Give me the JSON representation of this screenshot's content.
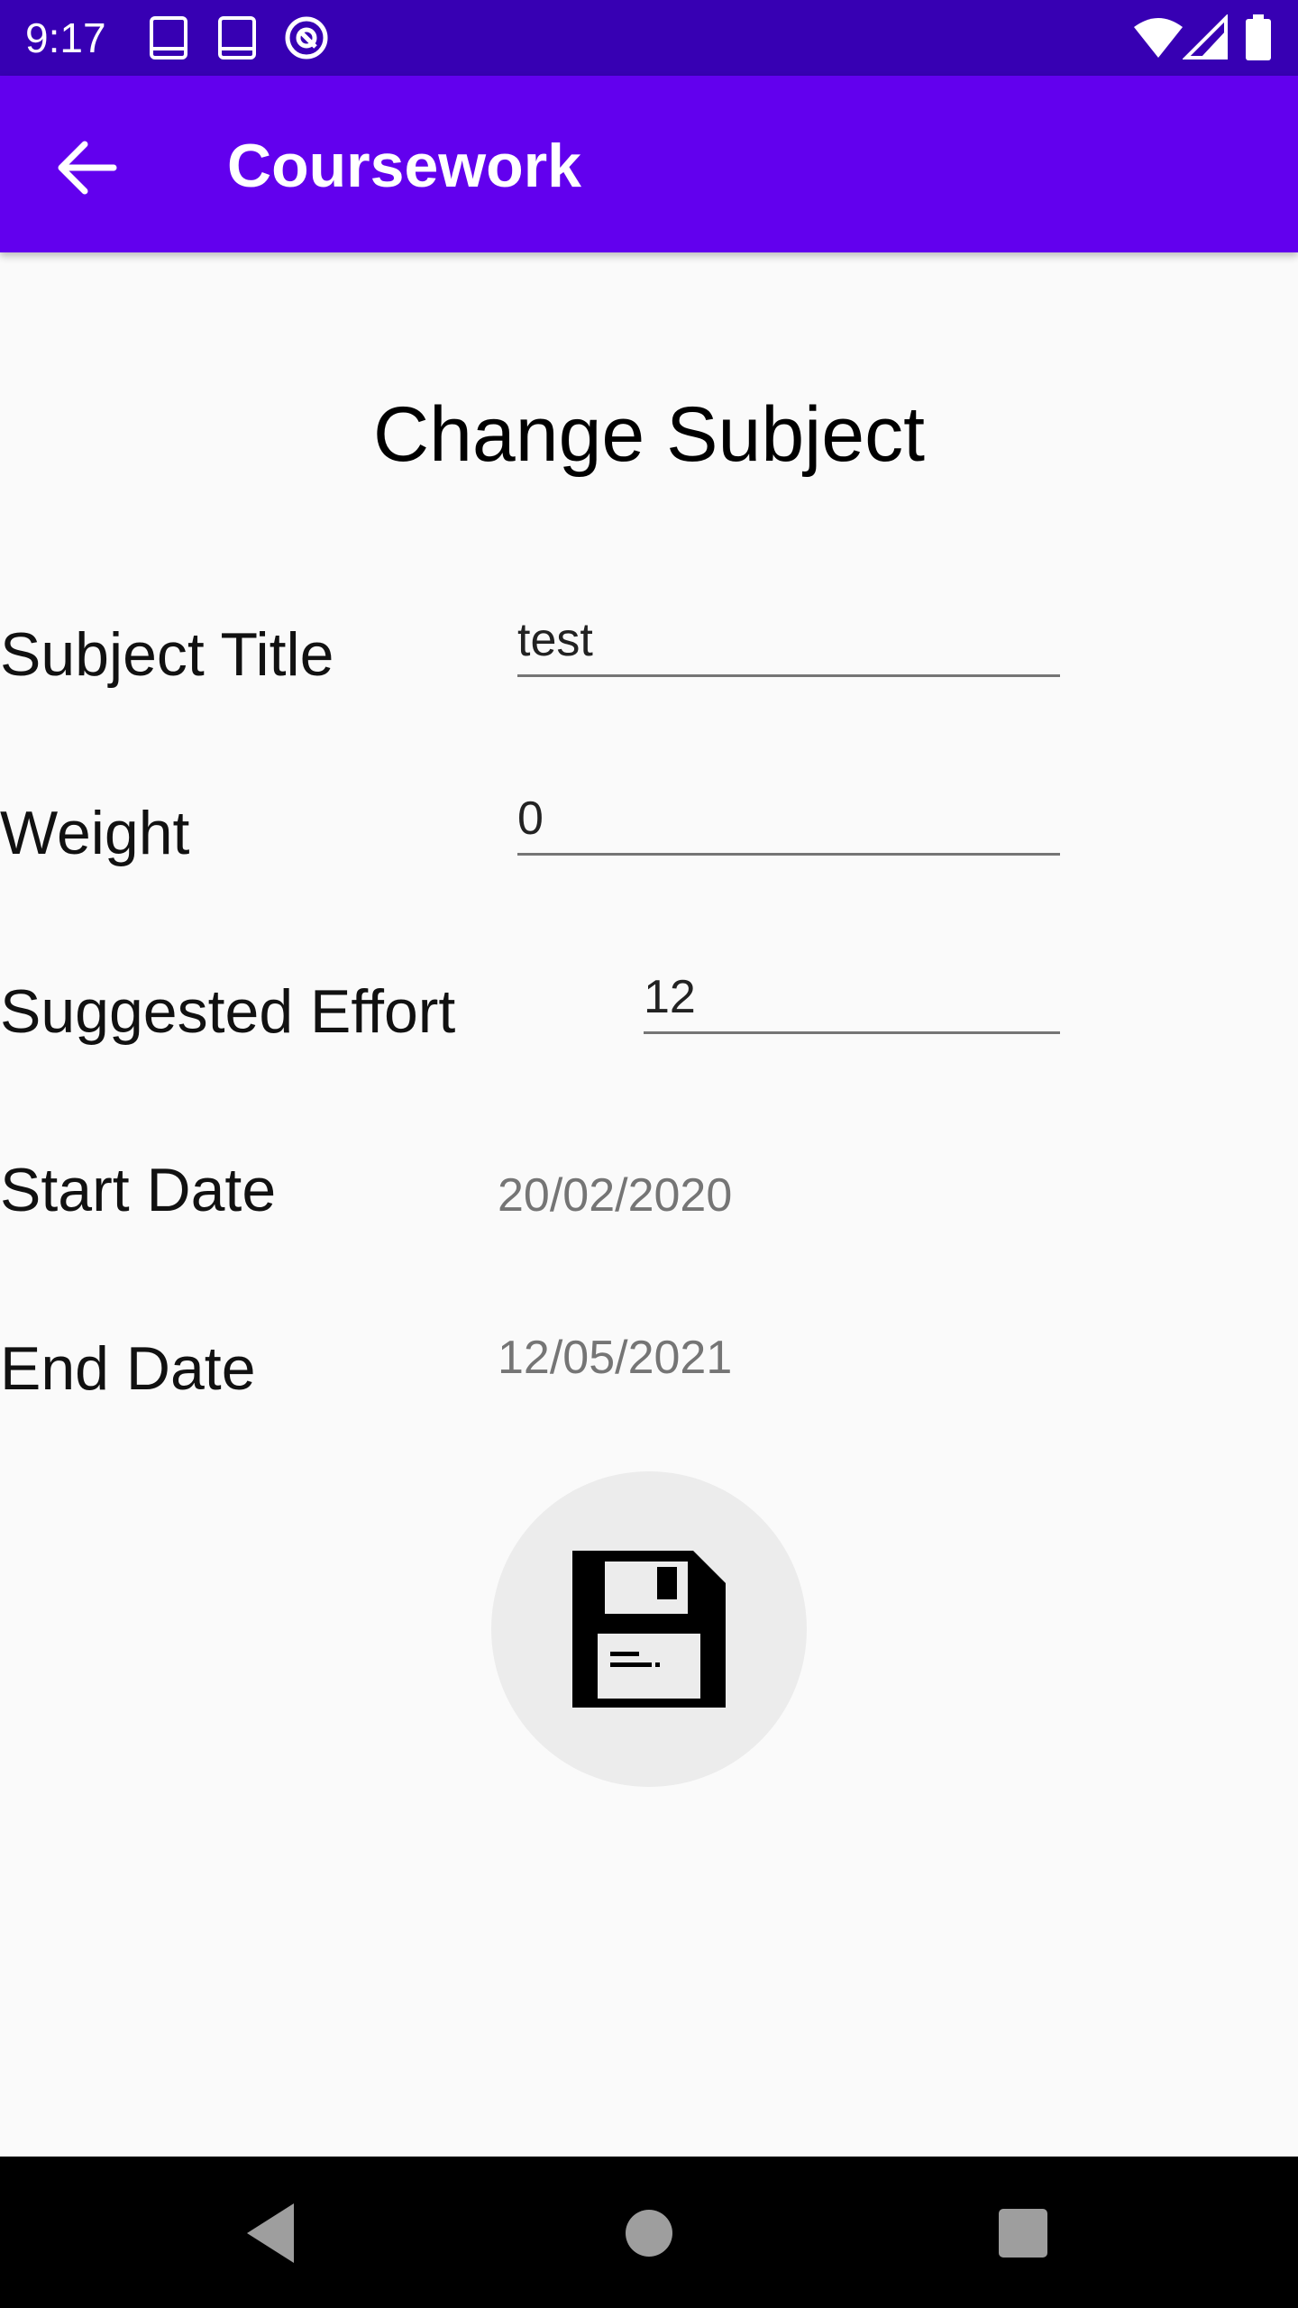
{
  "status_bar": {
    "time": "9:17",
    "left_icons": [
      "book-icon",
      "book-icon",
      "at-sign-icon"
    ],
    "right_icons": [
      "wifi-icon",
      "signal-icon",
      "battery-icon"
    ],
    "color": "#3700b3"
  },
  "app_bar": {
    "title": "Coursework",
    "back_icon": "arrow-back-icon",
    "color": "#6200ee"
  },
  "main": {
    "page_title": "Change Subject",
    "fields": {
      "subject_title": {
        "label": "Subject Title",
        "value": "test"
      },
      "weight": {
        "label": "Weight",
        "value": "0"
      },
      "suggested_effort": {
        "label": "Suggested Effort",
        "value": "12"
      },
      "start_date": {
        "label": "Start Date",
        "value": "20/02/2020"
      },
      "end_date": {
        "label": "End Date",
        "value": "12/05/2021"
      }
    },
    "save_button": {
      "icon": "floppy-disk-icon"
    }
  },
  "nav_bar": {
    "icons": [
      "nav-back-icon",
      "nav-home-icon",
      "nav-recents-icon"
    ]
  }
}
